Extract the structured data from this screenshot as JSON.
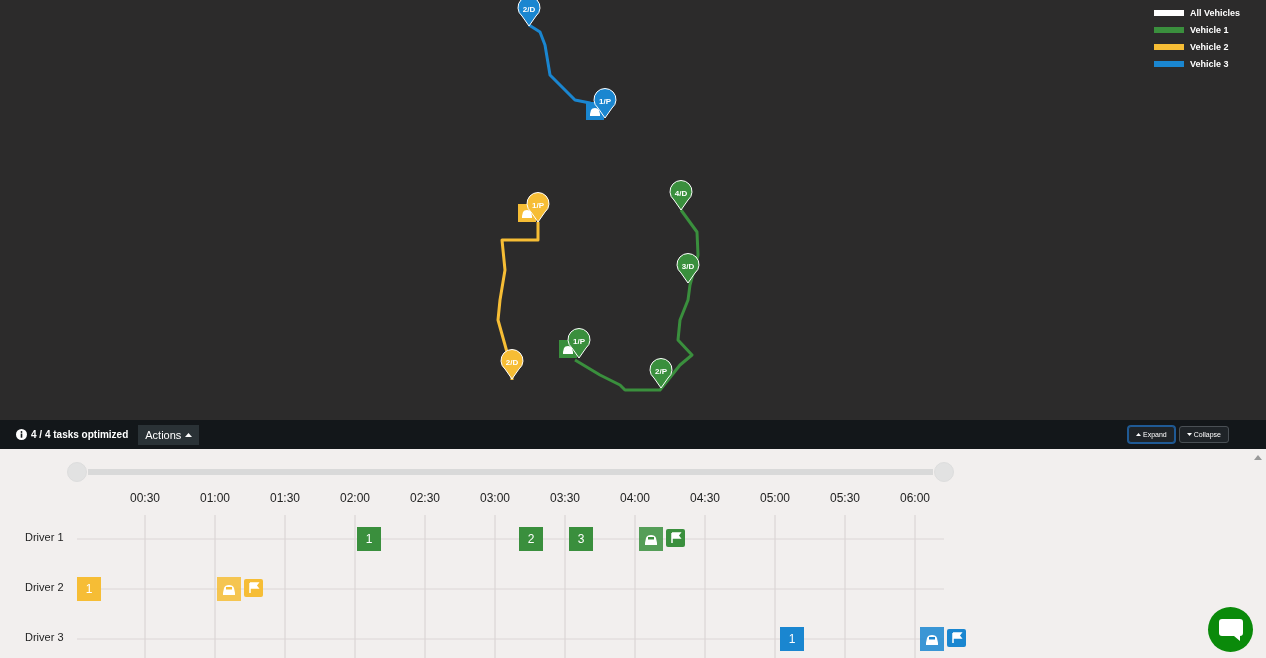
{
  "legend": [
    {
      "label": "All Vehicles",
      "color": "#ffffff"
    },
    {
      "label": "Vehicle 1",
      "color": "#3a8f3d"
    },
    {
      "label": "Vehicle 2",
      "color": "#f6bd35"
    },
    {
      "label": "Vehicle 3",
      "color": "#1a86d0"
    }
  ],
  "routes": [
    {
      "color": "#1a86d0",
      "markers": [
        {
          "label": "2/D"
        },
        {
          "label": "1/P"
        }
      ]
    },
    {
      "color": "#f6bd35",
      "markers": [
        {
          "label": "1/P"
        },
        {
          "label": "2/D"
        }
      ]
    },
    {
      "color": "#3a8f3d",
      "markers": [
        {
          "label": "4/D"
        },
        {
          "label": "3/D"
        },
        {
          "label": "2/P"
        },
        {
          "label": "1/P"
        }
      ]
    }
  ],
  "status": {
    "text": "4 / 4 tasks optimized"
  },
  "actions_button": {
    "label": "Actions"
  },
  "view_buttons": [
    {
      "label": "Expand",
      "selected": true
    },
    {
      "label": "Collapse",
      "selected": false
    }
  ],
  "timeline": {
    "ticks": [
      "00:30",
      "01:00",
      "01:30",
      "02:00",
      "02:30",
      "03:00",
      "03:30",
      "04:00",
      "04:30",
      "05:00",
      "05:30",
      "06:00"
    ],
    "rows": [
      {
        "label": "Driver 1",
        "color": "#3a8f3d",
        "tasks": [
          {
            "kind": "stop",
            "label": "1"
          },
          {
            "kind": "stop",
            "label": "2"
          },
          {
            "kind": "stop",
            "label": "3"
          },
          {
            "kind": "vehicle"
          },
          {
            "kind": "finish"
          }
        ]
      },
      {
        "label": "Driver 2",
        "color": "#f6bd35",
        "tasks": [
          {
            "kind": "stop",
            "label": "1"
          },
          {
            "kind": "vehicle"
          },
          {
            "kind": "finish"
          }
        ]
      },
      {
        "label": "Driver 3",
        "color": "#1a86d0",
        "tasks": [
          {
            "kind": "stop",
            "label": "1"
          },
          {
            "kind": "vehicle"
          },
          {
            "kind": "finish"
          }
        ]
      }
    ]
  }
}
